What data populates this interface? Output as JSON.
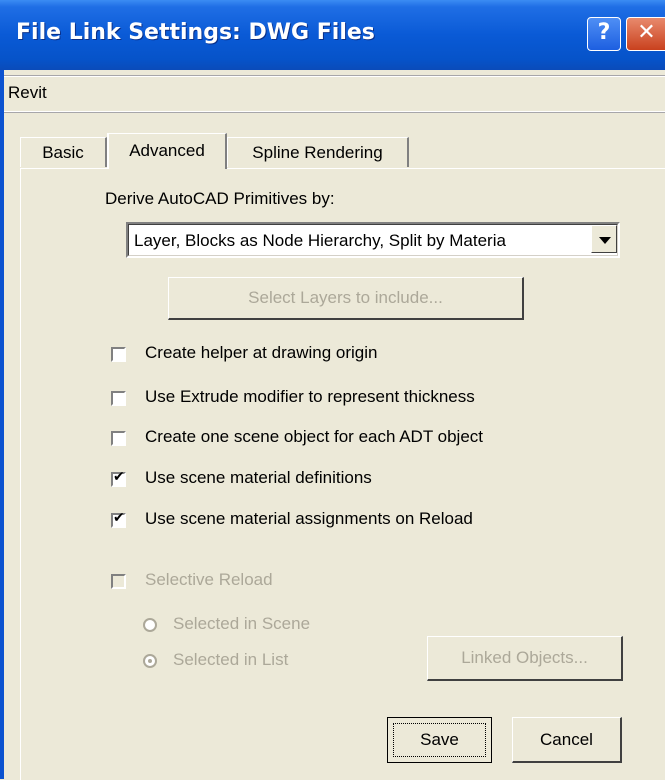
{
  "window": {
    "title": "File Link Settings: DWG Files",
    "help_glyph": "?",
    "close_glyph": "✕"
  },
  "preset": {
    "name": "Revit"
  },
  "tabs": [
    {
      "label": "Basic",
      "active": false
    },
    {
      "label": "Advanced",
      "active": true
    },
    {
      "label": "Spline Rendering",
      "active": false
    }
  ],
  "derive": {
    "label": "Derive AutoCAD Primitives by:",
    "selected": "Layer, Blocks as Node Hierarchy, Split by Materia"
  },
  "select_layers": {
    "label": "Select Layers to include...",
    "enabled": false
  },
  "options": [
    {
      "label": "Create helper at drawing origin",
      "checked": false
    },
    {
      "label": "Use Extrude modifier to represent thickness",
      "checked": false
    },
    {
      "label": "Create one scene object for each ADT object",
      "checked": false
    },
    {
      "label": "Use scene material definitions",
      "checked": true
    },
    {
      "label": "Use scene material assignments on Reload",
      "checked": true
    }
  ],
  "selective_reload": {
    "label": "Selective Reload",
    "checked": false,
    "enabled": false,
    "radios": [
      {
        "label": "Selected in Scene",
        "selected": false
      },
      {
        "label": "Selected in List",
        "selected": true
      }
    ],
    "linked_objects_label": "Linked Objects..."
  },
  "footer": {
    "save_label": "Save",
    "cancel_label": "Cancel"
  }
}
